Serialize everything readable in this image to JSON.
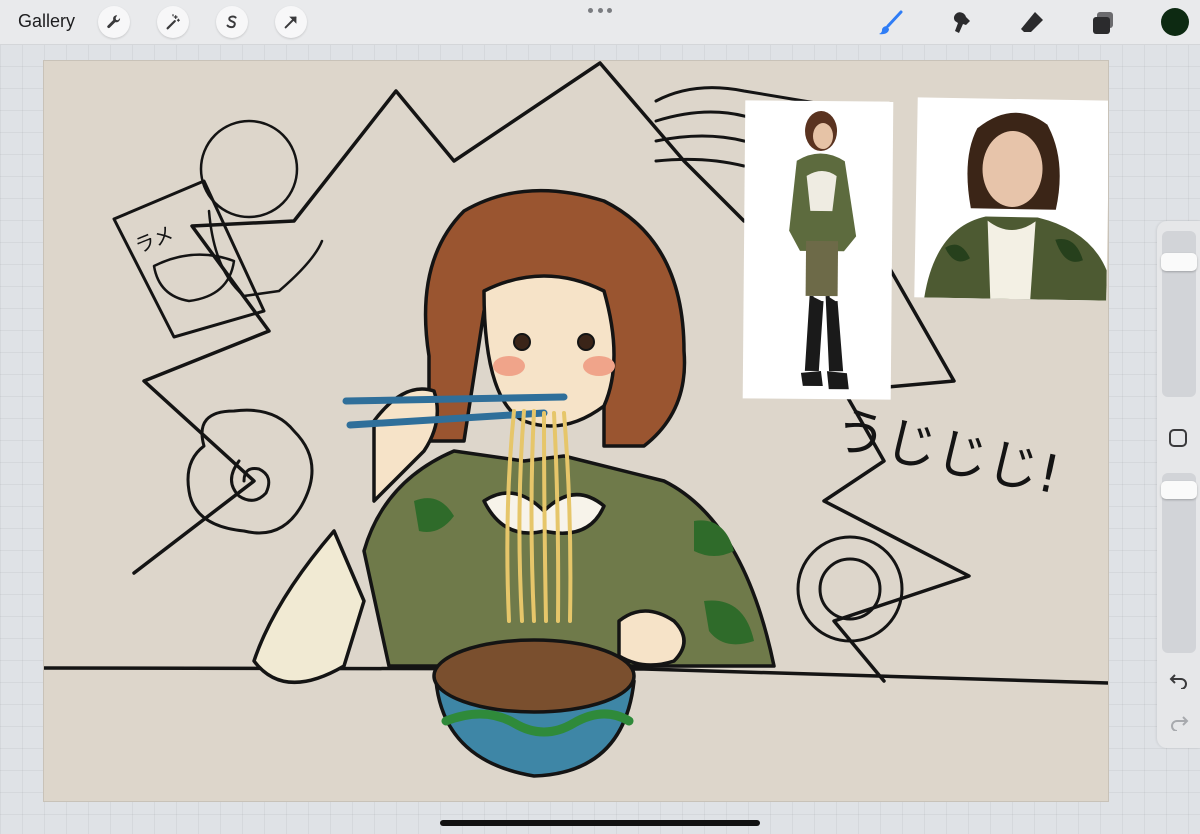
{
  "toolbar": {
    "gallery_label": "Gallery",
    "left_tools": [
      "wrench-icon",
      "magic-wand-icon",
      "selection-s-icon",
      "transform-arrow-icon"
    ],
    "right_tools": [
      "brush-icon",
      "smudge-icon",
      "eraser-icon",
      "layers-icon"
    ],
    "active_tool": "brush-icon",
    "active_color": "#0d2a12",
    "accent_color": "#2f7df6"
  },
  "sidebar": {
    "brush_size_level": 0.15,
    "opacity_level": 0.05,
    "buttons": [
      "modify-square-icon",
      "undo-icon",
      "redo-icon"
    ]
  },
  "canvas": {
    "background_color": "#ddd6cb",
    "handwritten_text": "うじじじ!",
    "package_text": "ラメ"
  }
}
